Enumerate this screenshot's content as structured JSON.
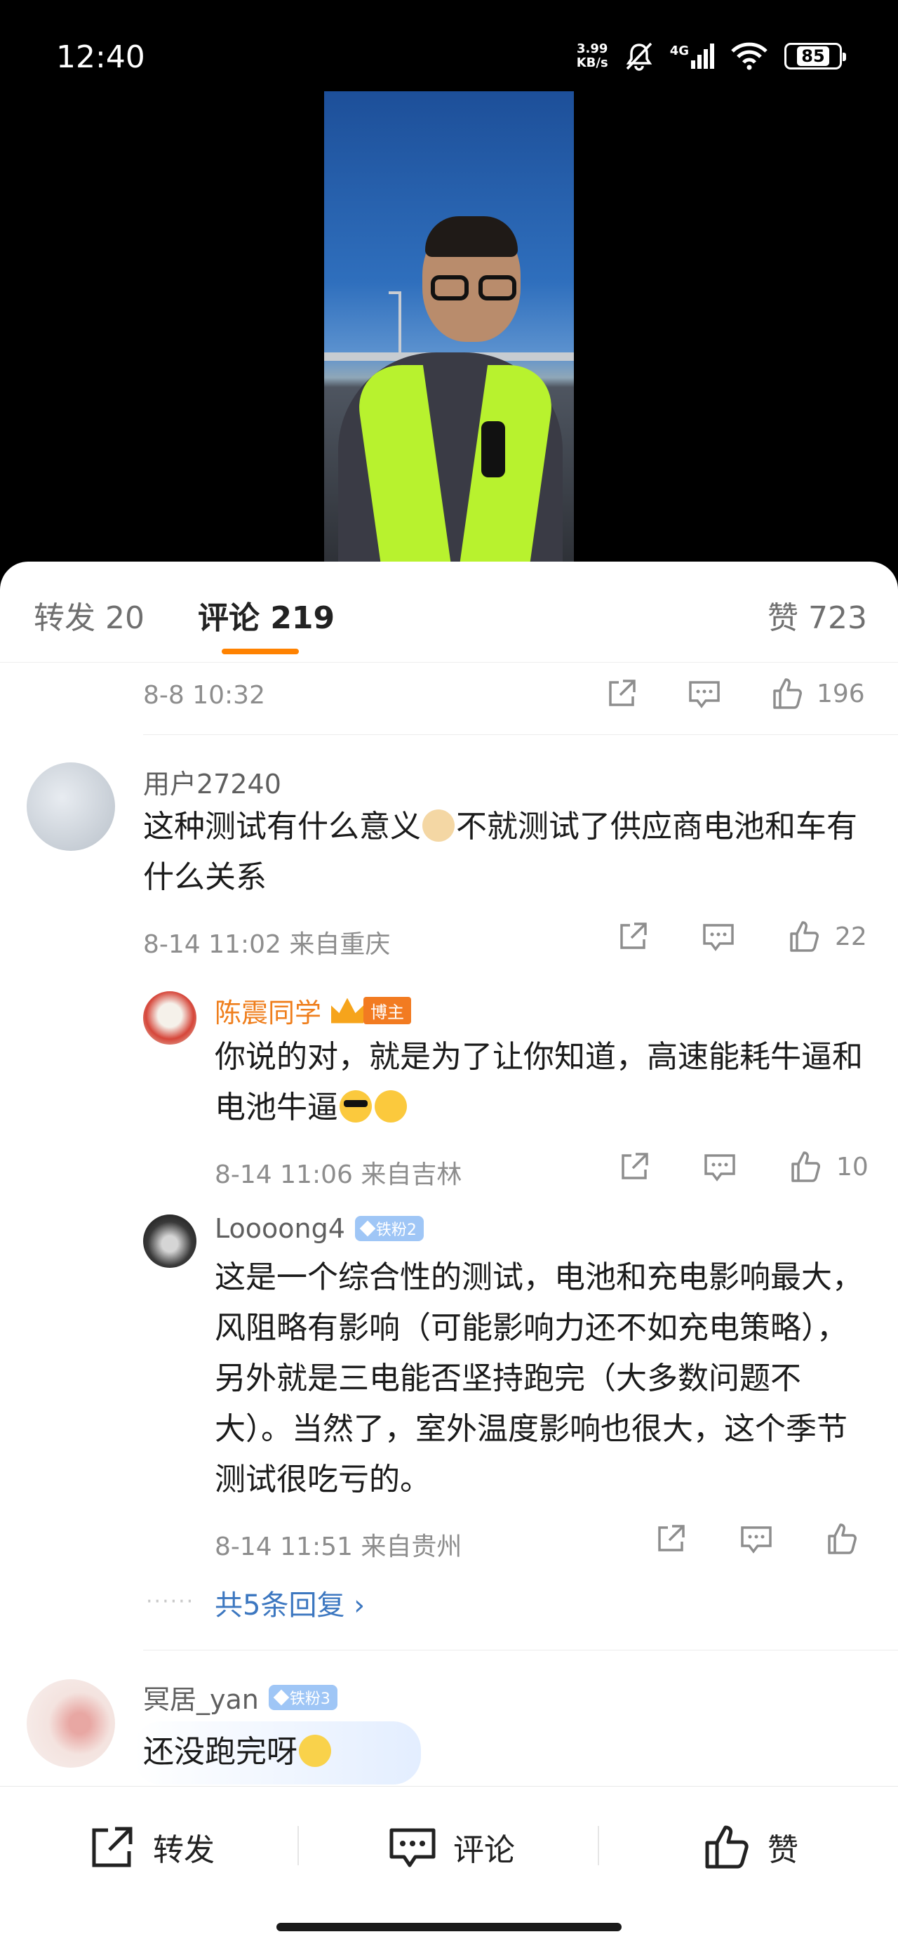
{
  "status_bar": {
    "time": "12:40",
    "net_speed_value": "3.99",
    "net_speed_unit": "KB/s",
    "network": "4G",
    "battery": "85"
  },
  "tabs": {
    "repost": "转发 20",
    "comment": "评论 219",
    "like": "赞 723"
  },
  "top_item": {
    "time": "8-8 10:32",
    "likes": "196"
  },
  "comments": [
    {
      "username": "用户27240",
      "text_a": "这种测试有什么意义",
      "text_b": "不就测试了供应商电池和车有什么关系",
      "time_loc": "8-14 11:02  来自重庆",
      "likes": "22",
      "replies": [
        {
          "username": "陈震同学",
          "badge": "博主",
          "text": "你说的对，就是为了让你知道，高速能耗牛逼和电池牛逼",
          "time_loc": "8-14 11:06  来自吉林",
          "likes": "10"
        },
        {
          "username": "Loooong4",
          "badge": "铁粉2",
          "text": "这是一个综合性的测试，电池和充电影响最大，风阻略有影响（可能影响力还不如充电策略），另外就是三电能否坚持跑完（大多数问题不大）。当然了，室外温度影响也很大，这个季节测试很吃亏的。",
          "time_loc": "8-14 11:51  来自贵州",
          "likes": ""
        }
      ],
      "more_replies": "共5条回复 ›"
    },
    {
      "username": "冥居_yan",
      "badge": "铁粉3",
      "text": "还没跑完呀"
    }
  ],
  "bottom_bar": {
    "repost": "转发",
    "comment": "评论",
    "like": "赞"
  }
}
